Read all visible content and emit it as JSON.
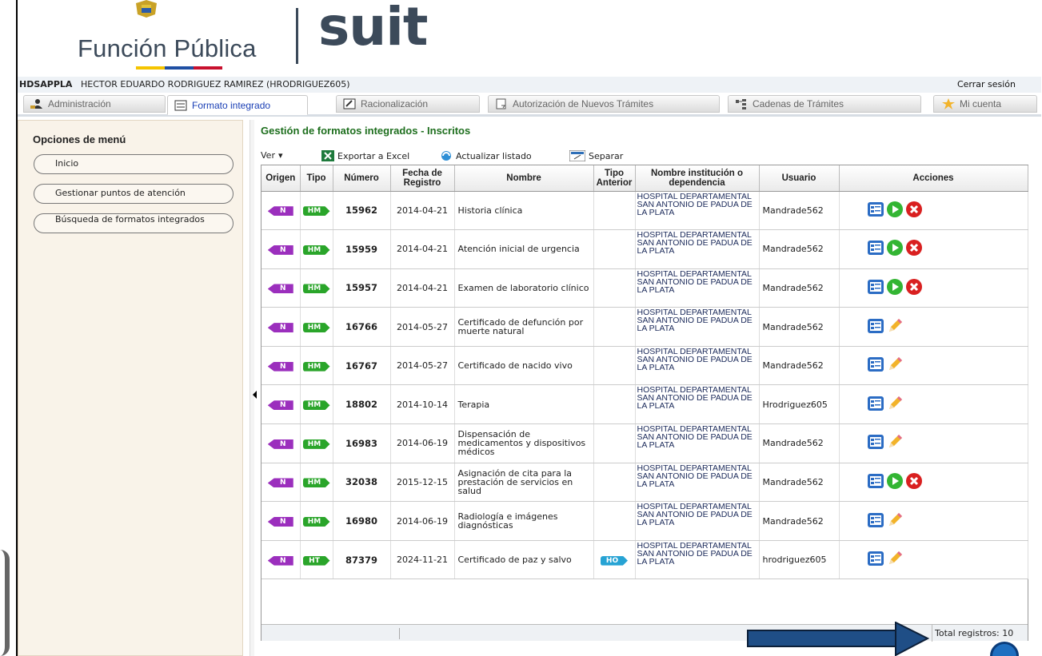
{
  "header": {
    "brand": "Función Pública",
    "product": "suit"
  },
  "user": {
    "code": "HDSAPPLA",
    "name": "HECTOR EDUARDO RODRIGUEZ RAMIREZ (HRODRIGUEZ605)",
    "logout": "Cerrar sesión"
  },
  "tabs": [
    {
      "label": "Administración",
      "icon": "admin-icon",
      "active": false
    },
    {
      "label": "Formato integrado",
      "icon": "form-icon",
      "active": true
    },
    {
      "label": "Racionalización",
      "icon": "edit-icon",
      "active": false
    },
    {
      "label": "Autorización de Nuevos Trámites",
      "icon": "authorize-icon",
      "active": false
    },
    {
      "label": "Cadenas de Trámites",
      "icon": "chain-icon",
      "active": false
    },
    {
      "label": "Mi cuenta",
      "icon": "star-icon",
      "active": false
    }
  ],
  "sidebar": {
    "title": "Opciones de menú",
    "items": [
      "Inicio",
      "Gestionar puntos de atención",
      "Búsqueda de formatos integrados"
    ]
  },
  "main": {
    "title": "Gestión de formatos integrados - Inscritos",
    "toolbar": {
      "view": "Ver",
      "export": "Exportar a Excel",
      "refresh": "Actualizar listado",
      "split": "Separar"
    },
    "columns": [
      "Origen",
      "Tipo",
      "Número",
      "Fecha de Registro",
      "Nombre",
      "Tipo Anterior",
      "Nombre institución o dependencia",
      "Usuario",
      "Acciones"
    ],
    "rows": [
      {
        "origen": "N",
        "tipo": "HM",
        "numero": "15962",
        "fecha": "2014-04-21",
        "nombre": "Historia clínica",
        "tipo_anterior": "",
        "institucion": "HOSPITAL DEPARTAMENTAL SAN ANTONIO DE PADUA DE LA PLATA",
        "usuario": "Mandrade562",
        "acciones": "view-play-delete"
      },
      {
        "origen": "N",
        "tipo": "HM",
        "numero": "15959",
        "fecha": "2014-04-21",
        "nombre": "Atención inicial de urgencia",
        "tipo_anterior": "",
        "institucion": "HOSPITAL DEPARTAMENTAL SAN ANTONIO DE PADUA DE LA PLATA",
        "usuario": "Mandrade562",
        "acciones": "view-play-delete"
      },
      {
        "origen": "N",
        "tipo": "HM",
        "numero": "15957",
        "fecha": "2014-04-21",
        "nombre": "Examen de laboratorio clínico",
        "tipo_anterior": "",
        "institucion": "HOSPITAL DEPARTAMENTAL SAN ANTONIO DE PADUA DE LA PLATA",
        "usuario": "Mandrade562",
        "acciones": "view-play-delete"
      },
      {
        "origen": "N",
        "tipo": "HM",
        "numero": "16766",
        "fecha": "2014-05-27",
        "nombre": "Certificado de defunción por muerte natural",
        "tipo_anterior": "",
        "institucion": "HOSPITAL DEPARTAMENTAL SAN ANTONIO DE PADUA DE LA PLATA",
        "usuario": "Mandrade562",
        "acciones": "view-edit"
      },
      {
        "origen": "N",
        "tipo": "HM",
        "numero": "16767",
        "fecha": "2014-05-27",
        "nombre": "Certificado de nacido vivo",
        "tipo_anterior": "",
        "institucion": "HOSPITAL DEPARTAMENTAL SAN ANTONIO DE PADUA DE LA PLATA",
        "usuario": "Mandrade562",
        "acciones": "view-edit"
      },
      {
        "origen": "N",
        "tipo": "HM",
        "numero": "18802",
        "fecha": "2014-10-14",
        "nombre": "Terapia",
        "tipo_anterior": "",
        "institucion": "HOSPITAL DEPARTAMENTAL SAN ANTONIO DE PADUA DE LA PLATA",
        "usuario": "Hrodriguez605",
        "acciones": "view-edit"
      },
      {
        "origen": "N",
        "tipo": "HM",
        "numero": "16983",
        "fecha": "2014-06-19",
        "nombre": "Dispensación de medicamentos y dispositivos médicos",
        "tipo_anterior": "",
        "institucion": "HOSPITAL DEPARTAMENTAL SAN ANTONIO DE PADUA DE LA PLATA",
        "usuario": "Mandrade562",
        "acciones": "view-edit"
      },
      {
        "origen": "N",
        "tipo": "HM",
        "numero": "32038",
        "fecha": "2015-12-15",
        "nombre": "Asignación de cita para la prestación de servicios en salud",
        "tipo_anterior": "",
        "institucion": "HOSPITAL DEPARTAMENTAL SAN ANTONIO DE PADUA DE LA PLATA",
        "usuario": "Mandrade562",
        "acciones": "view-play-delete"
      },
      {
        "origen": "N",
        "tipo": "HM",
        "numero": "16980",
        "fecha": "2014-06-19",
        "nombre": "Radiología e imágenes diagnósticas",
        "tipo_anterior": "",
        "institucion": "HOSPITAL DEPARTAMENTAL SAN ANTONIO DE PADUA DE LA PLATA",
        "usuario": "Mandrade562",
        "acciones": "view-edit"
      },
      {
        "origen": "N",
        "tipo": "HT",
        "numero": "87379",
        "fecha": "2024-11-21",
        "nombre": "Certificado de paz y salvo",
        "tipo_anterior": "HO",
        "institucion": "HOSPITAL DEPARTAMENTAL SAN ANTONIO DE PADUA DE LA PLATA",
        "usuario": "hrodriguez605",
        "acciones": "view-edit"
      }
    ],
    "total": "Total registros: 10"
  },
  "colors": {
    "title_green": "#1d6e1d",
    "tag_purple": "#9b2fbd",
    "tag_green": "#2aa52a",
    "tag_blue": "#27a3d4",
    "brand_slate": "#3c4a5a"
  }
}
